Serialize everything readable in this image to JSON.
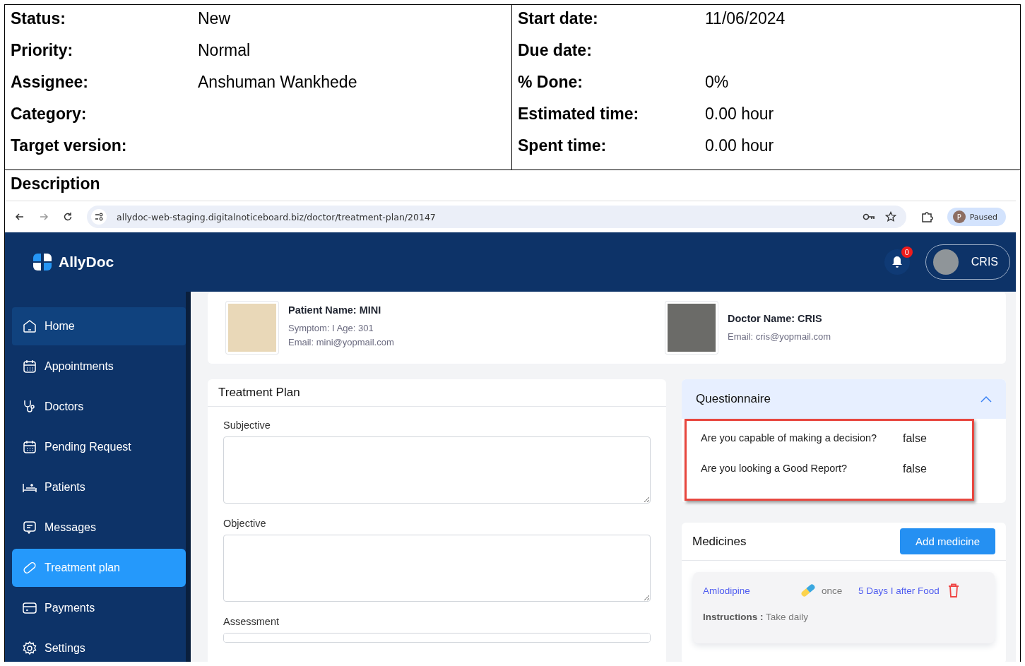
{
  "issue_attributes": {
    "left": [
      {
        "label": "Status:",
        "value": "New"
      },
      {
        "label": "Priority:",
        "value": "Normal"
      },
      {
        "label": "Assignee:",
        "value": "Anshuman Wankhede"
      },
      {
        "label": "Category:"
      },
      {
        "label": "Target version:"
      }
    ],
    "right": [
      {
        "label": "Start date:",
        "value": "11/06/2024"
      },
      {
        "label": "Due date:"
      },
      {
        "label": "% Done:",
        "value": "0%"
      },
      {
        "label": "Estimated time:",
        "value": "0.00 hour"
      },
      {
        "label": "Spent time:",
        "value": "0.00 hour"
      }
    ]
  },
  "description_heading": "Description",
  "browser": {
    "url": "allydoc-web-staging.digitalnoticeboard.biz/doctor/treatment-plan/20147",
    "profile_initial": "P",
    "profile_status": "Paused"
  },
  "app": {
    "logo": "AllyDoc",
    "notification_count": "0",
    "user_name": "CRIS",
    "sidebar": [
      {
        "label": "Home",
        "kind": "home",
        "selected": false,
        "hovered": true
      },
      {
        "label": "Appointments",
        "kind": "calendar",
        "selected": false,
        "hovered": false
      },
      {
        "label": "Doctors",
        "kind": "stethoscope",
        "selected": false,
        "hovered": false
      },
      {
        "label": "Pending Request",
        "kind": "calendar",
        "selected": false,
        "hovered": false
      },
      {
        "label": "Patients",
        "kind": "bed",
        "selected": false,
        "hovered": false
      },
      {
        "label": "Messages",
        "kind": "message",
        "selected": false,
        "hovered": false
      },
      {
        "label": "Treatment plan",
        "kind": "pill",
        "selected": true,
        "hovered": false
      },
      {
        "label": "Payments",
        "kind": "card",
        "selected": false,
        "hovered": false
      },
      {
        "label": "Settings",
        "kind": "gear",
        "selected": false,
        "hovered": false
      }
    ],
    "patient": {
      "name": "Patient Name: MINI",
      "details": "Symptom: I Age: 301",
      "email": "Email: mini@yopmail.com"
    },
    "doctor": {
      "name": "Doctor Name: CRIS",
      "email": "Email: cris@yopmail.com"
    },
    "treatment_plan": {
      "title": "Treatment Plan",
      "fields": [
        {
          "label": "Subjective"
        },
        {
          "label": "Objective"
        },
        {
          "label": "Assessment"
        }
      ]
    },
    "questionnaire": {
      "title": "Questionnaire",
      "expanded": true,
      "rows": [
        {
          "question": "Are you capable of making a decision?",
          "answer": "false"
        },
        {
          "question": "Are you looking a Good Report?",
          "answer": "false"
        }
      ]
    },
    "medicines": {
      "title": "Medicines",
      "add_button": "Add medicine",
      "items": [
        {
          "name": "Amlodipine",
          "frequency": "once",
          "schedule": "5 Days I after Food",
          "instructions": "**Instructions :** Take daily"
        }
      ]
    }
  }
}
